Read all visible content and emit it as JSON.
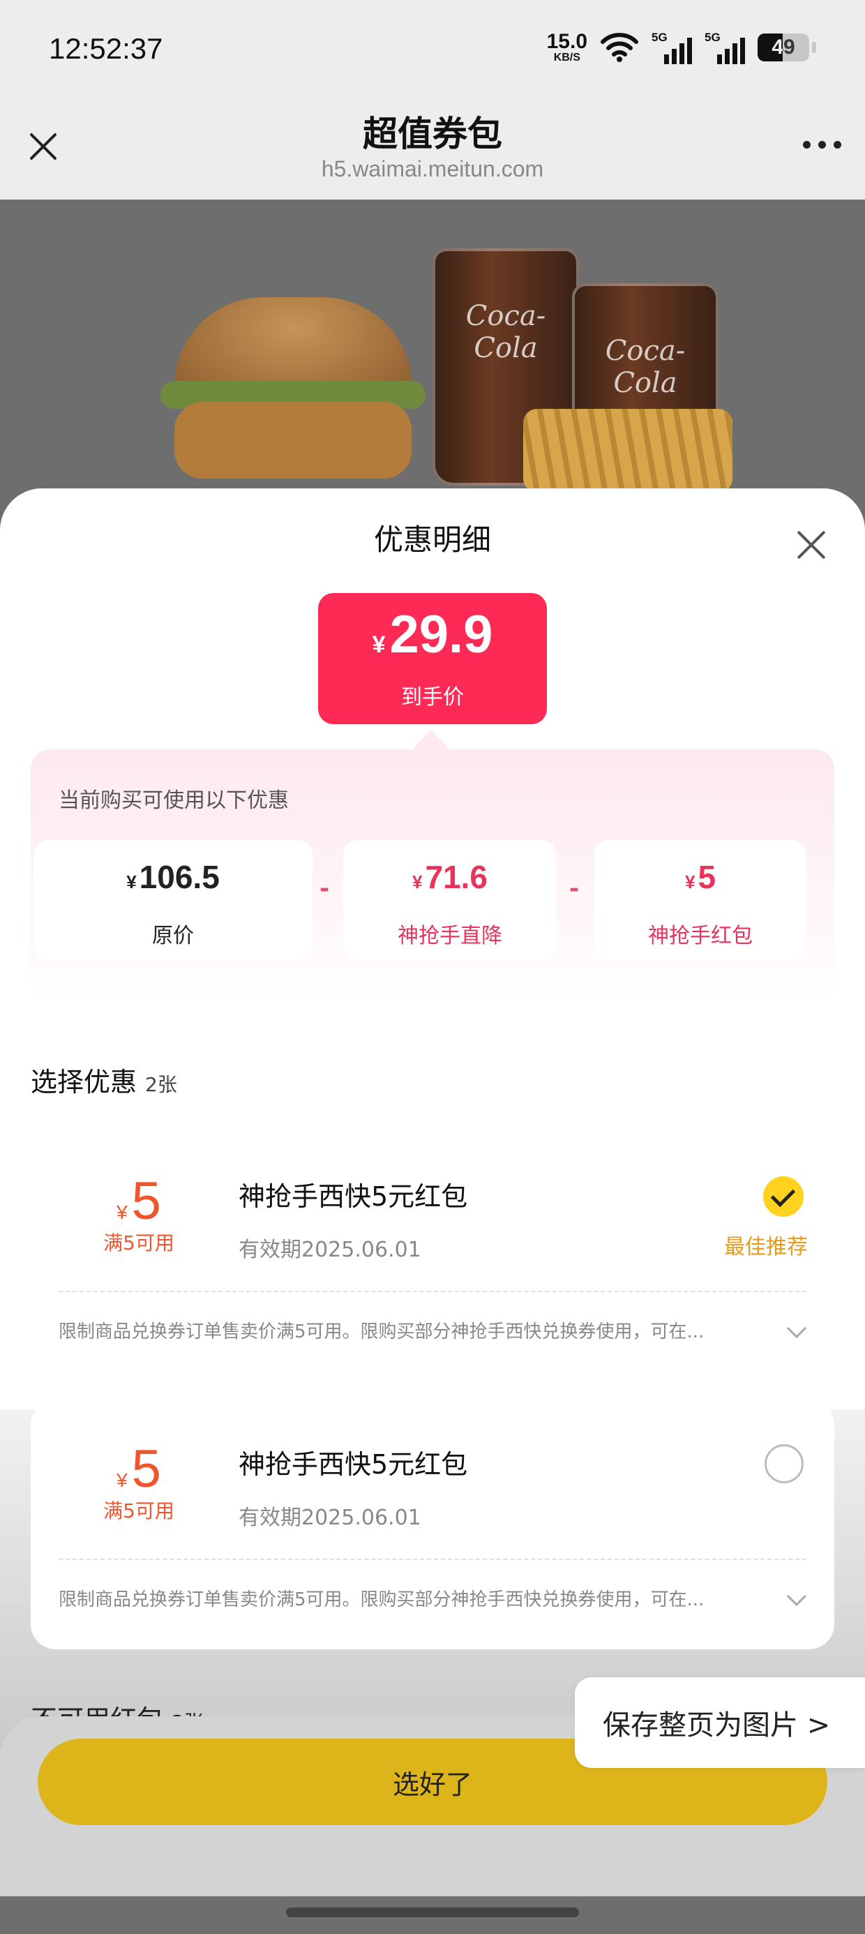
{
  "status_bar": {
    "time": "12:52:37",
    "net_speed_value": "15.0",
    "net_speed_unit": "KB/S",
    "signal1_label": "5G",
    "signal2_label": "5G",
    "battery": "49",
    "icons": [
      "wifi-icon",
      "signal-icon",
      "battery-icon"
    ]
  },
  "title_bar": {
    "title": "超值券包",
    "url": "h5.waimai.meitun.com",
    "icons": [
      "close-icon",
      "more-icon"
    ]
  },
  "hero": {
    "cup_text": "Coca-Cola"
  },
  "sheet": {
    "title": "优惠明细",
    "price": {
      "currency": "¥",
      "amount": "29.9",
      "label": "到手价"
    },
    "panel_note": "当前购买可使用以下优惠",
    "breakdown": [
      {
        "currency": "¥",
        "value": "106.5",
        "label": "原价",
        "color": "#222222"
      },
      {
        "currency": "¥",
        "value": "71.6",
        "label": "神抢手直降",
        "color": "#e8345c"
      },
      {
        "currency": "¥",
        "value": "5",
        "label": "神抢手红包",
        "color": "#e8345c"
      }
    ],
    "operator": "-",
    "section_title": "选择优惠",
    "section_count": "2张",
    "coupons": [
      {
        "currency": "¥",
        "amount": "5",
        "condition": "满5可用",
        "name": "神抢手西快5元红包",
        "expiry": "有效期2025.06.01",
        "description": "限制商品兑换券订单售卖价满5可用。限购买部分神抢手西快兑换券使用，可在...",
        "selected": true,
        "tag": "最佳推荐"
      },
      {
        "currency": "¥",
        "amount": "5",
        "condition": "满5可用",
        "name": "神抢手西快5元红包",
        "expiry": "有效期2025.06.01",
        "description": "限制商品兑换券订单售卖价满5可用。限购买部分神抢手西快兑换券使用，可在...",
        "selected": false
      }
    ],
    "peek_title": "不可用红包",
    "peek_count": "2张"
  },
  "bottom": {
    "confirm_label": "选好了",
    "save_float_label": "保存整页为图片 >"
  },
  "colors": {
    "price_red": "#fd2a56",
    "coupon_orange": "#f0562e",
    "check_yellow": "#ffd21f",
    "confirm_yellow": "#ddb51b",
    "tag_orange": "#e89a1a"
  }
}
